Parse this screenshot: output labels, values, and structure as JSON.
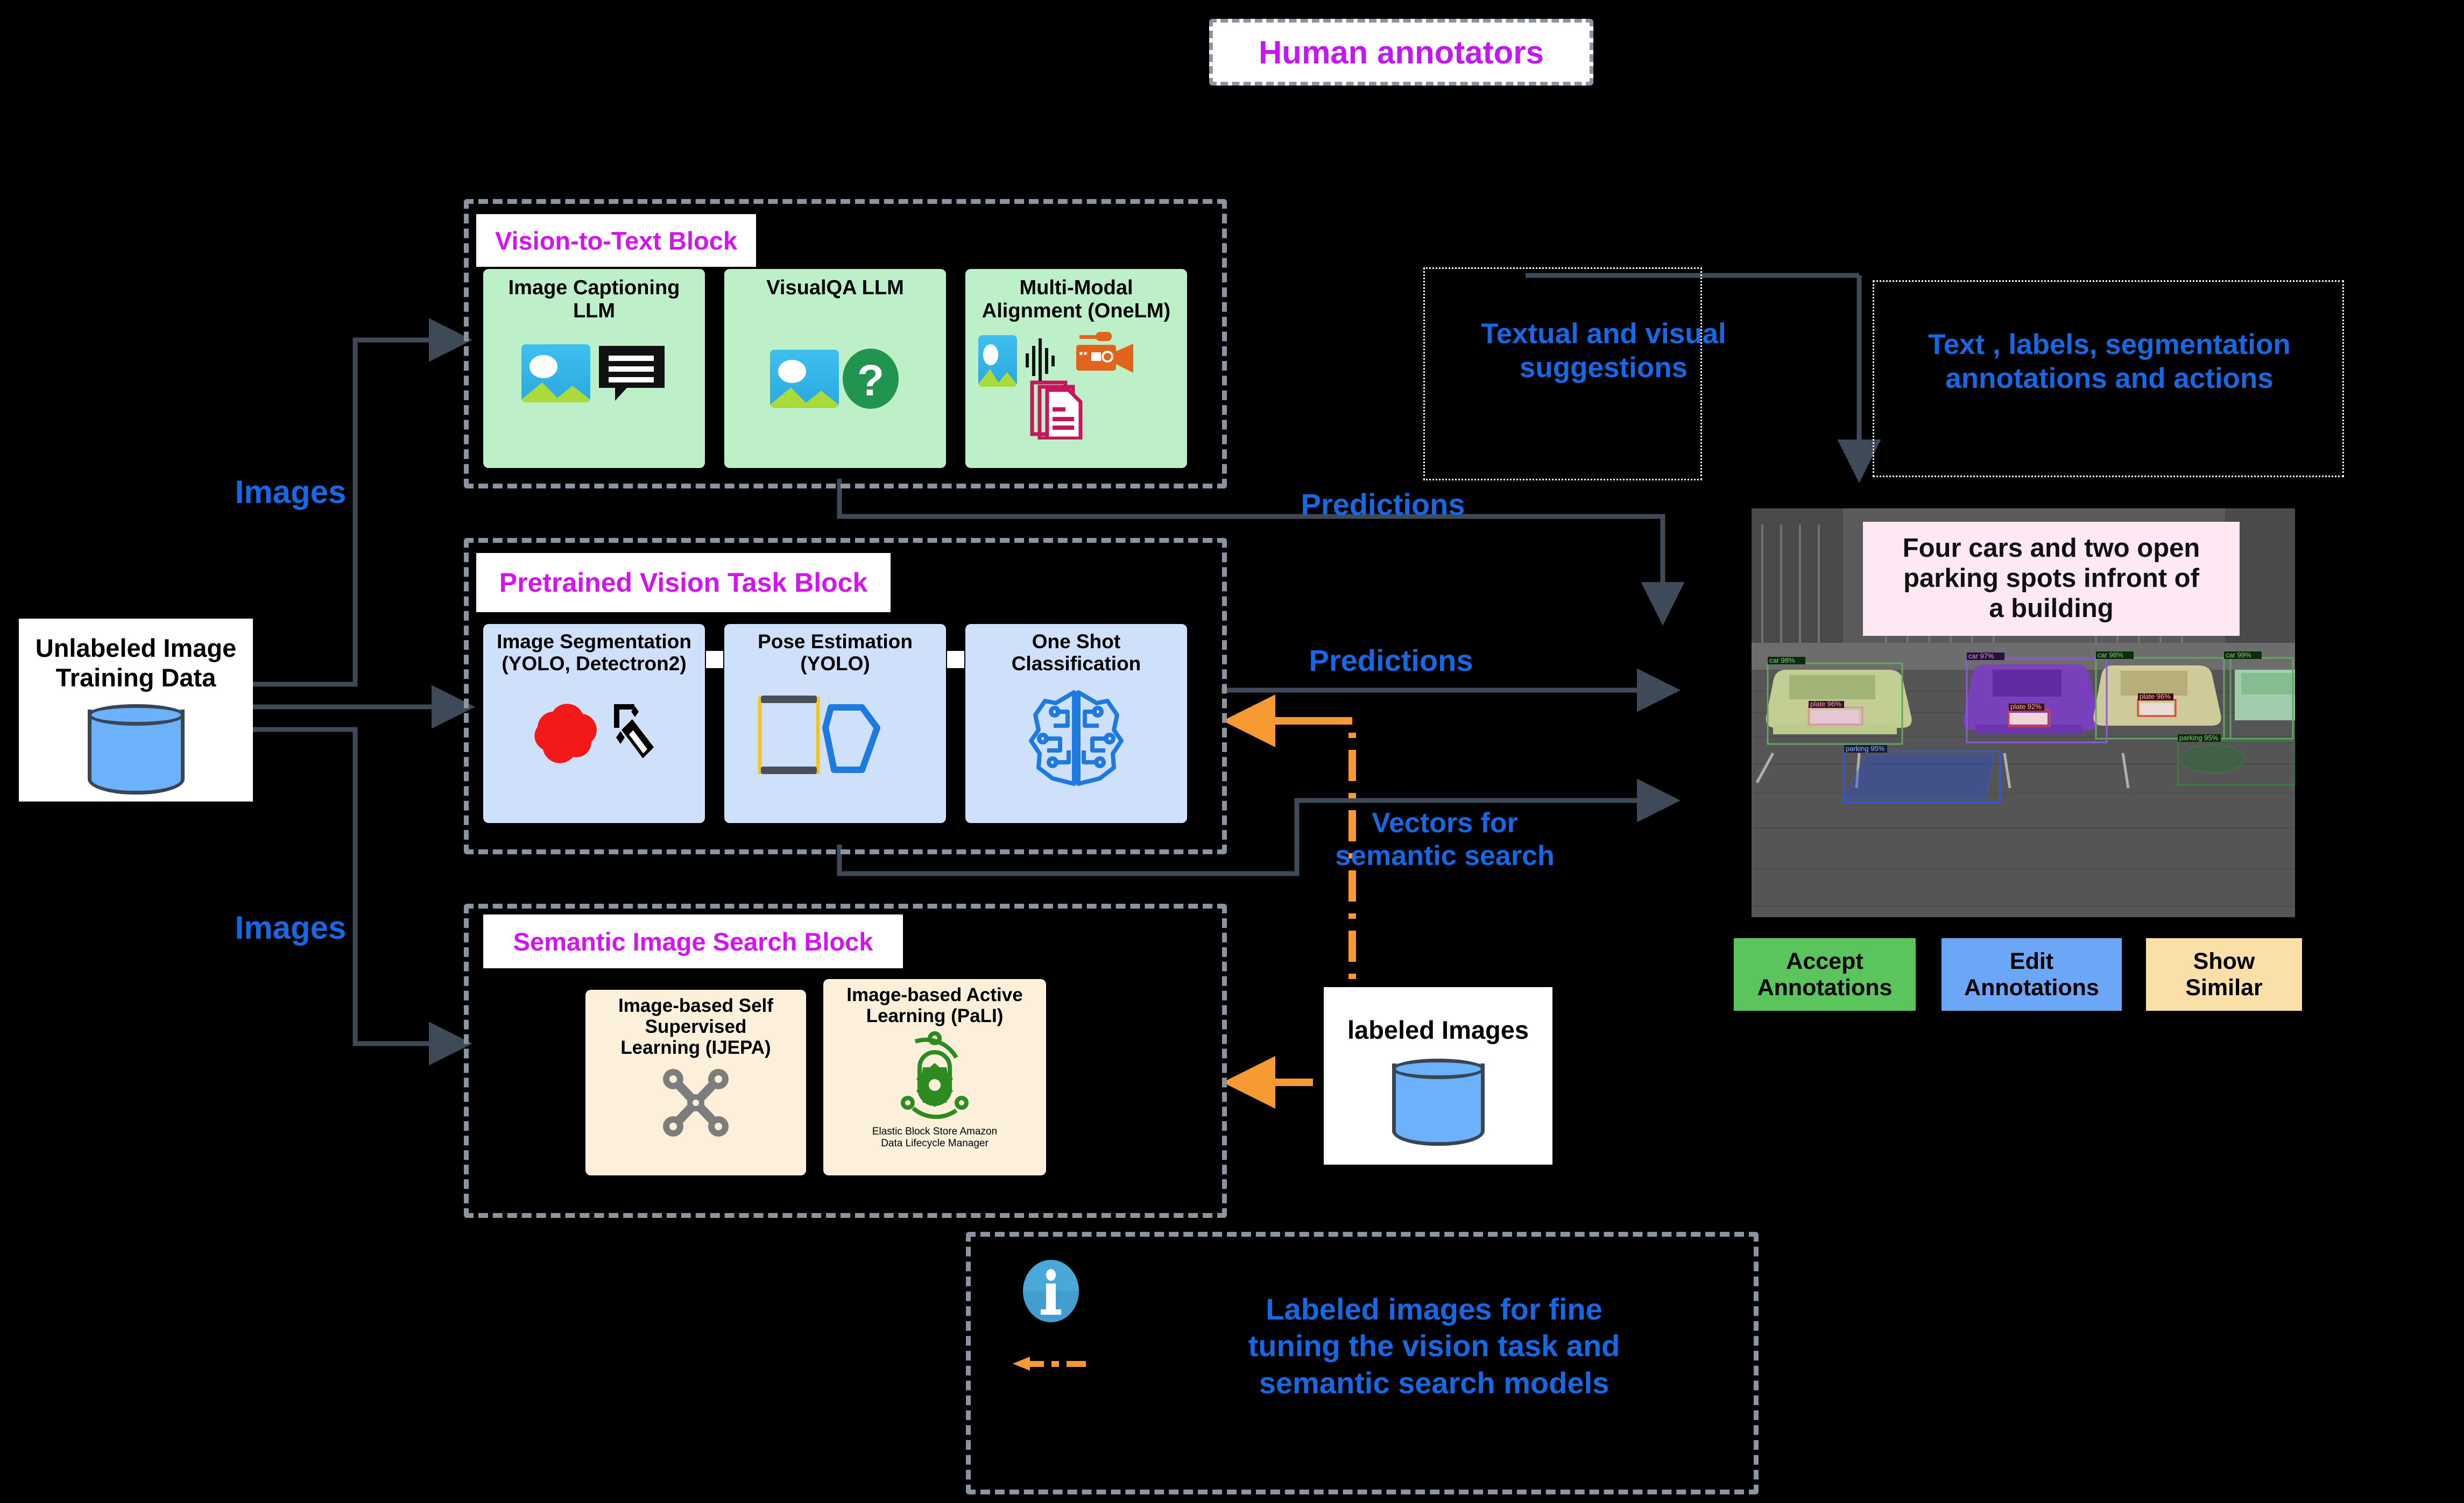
{
  "human_annotators": {
    "label": "Human annotators"
  },
  "source": {
    "title_line1": "Unlabeled Image",
    "title_line2": "Training Data",
    "icon": "database-cylinder-icon"
  },
  "labeled_images": {
    "label": "labeled Images",
    "icon": "database-cylinder-icon"
  },
  "blocks": [
    {
      "id": "vision-to-text",
      "title": "Vision-to-Text Block",
      "cards": [
        {
          "lines": [
            "Image Captioning",
            "LLM"
          ],
          "icon": "image-and-text-bubble-icon"
        },
        {
          "lines": [
            "VisualQA LLM"
          ],
          "icon": "image-and-question-mark-icon"
        },
        {
          "lines": [
            "Multi-Modal",
            "Alignment (OneLM)"
          ],
          "icon": "image-audio-video-document-icon"
        }
      ]
    },
    {
      "id": "pretrained-vision-task",
      "title": "Pretrained Vision Task Block",
      "cards": [
        {
          "lines": [
            "Image Segmentation",
            "(YOLO, Detectron2)"
          ],
          "icon": "segmentation-wand-icon"
        },
        {
          "lines": [
            "Pose Estimation",
            "(YOLO)"
          ],
          "icon": "pose-keypoints-icon"
        },
        {
          "lines": [
            "One Shot",
            "Classification"
          ],
          "icon": "brain-circuit-icon"
        }
      ]
    },
    {
      "id": "semantic-image-search",
      "title": "Semantic Image Search Block",
      "cards": [
        {
          "lines": [
            "Image-based Self",
            "Supervised",
            "Learning (IJEPA)"
          ],
          "icon": "node-graph-icon",
          "caption": ""
        },
        {
          "lines": [
            "Image-based Active",
            "Learning (PaLI)"
          ],
          "icon": "lifecycle-gear-icon",
          "caption_line1": "Elastic Block Store Amazon",
          "caption_line2": "Data Lifecycle Manager"
        }
      ]
    }
  ],
  "flow_labels": {
    "images_top": "Images",
    "images_bottom": "Images",
    "predictions_top": "Predictions",
    "predictions_bottom": "Predictions",
    "vectors_line1": "Vectors for",
    "vectors_line2": "semantic search",
    "suggestions_line1": "Textual and  visual",
    "suggestions_line2": "suggestions",
    "annotations_line1": "Text , labels, segmentation",
    "annotations_line2": "annotations and actions"
  },
  "annotation_panel": {
    "caption_line1": "Four cars and two open",
    "caption_line2": "parking spots infront of",
    "caption_line3": "a building",
    "detections": [
      {
        "label": "car 98%"
      },
      {
        "label": "car 97%"
      },
      {
        "label": "car 98%"
      },
      {
        "label": "car 99%"
      },
      {
        "label": "plate 96%"
      },
      {
        "label": "plate 92%"
      },
      {
        "label": "plate 96%"
      },
      {
        "label": "parking 95%"
      },
      {
        "label": "parking 95%"
      }
    ],
    "buttons": [
      {
        "line1": "Accept",
        "line2": "Annotations",
        "color": "#5cc45c"
      },
      {
        "line1": "Edit",
        "line2": "Annotations",
        "color": "#6ba6f7"
      },
      {
        "line1": "Show",
        "line2": "Similar",
        "color": "#fadfa8"
      }
    ]
  },
  "footer_note": {
    "icon": "info-circle-icon",
    "line1": "Labeled images for fine",
    "line2": "tuning the vision task and",
    "line3": "semantic search models",
    "legend_icon": "orange-dash-dot-arrow-icon"
  },
  "colors": {
    "background": "#000000",
    "block_border": "#8b95a1",
    "block_title_text": "#d414f0",
    "flow_text": "#1668e3",
    "vision_card": "#bdf0c8",
    "pretrained_card": "#cfe0fb",
    "semantic_card": "#fcf0da",
    "arrow": "#3f4a58",
    "orange_arrow": "#f79a33",
    "annotator_text": "#c119f0"
  }
}
